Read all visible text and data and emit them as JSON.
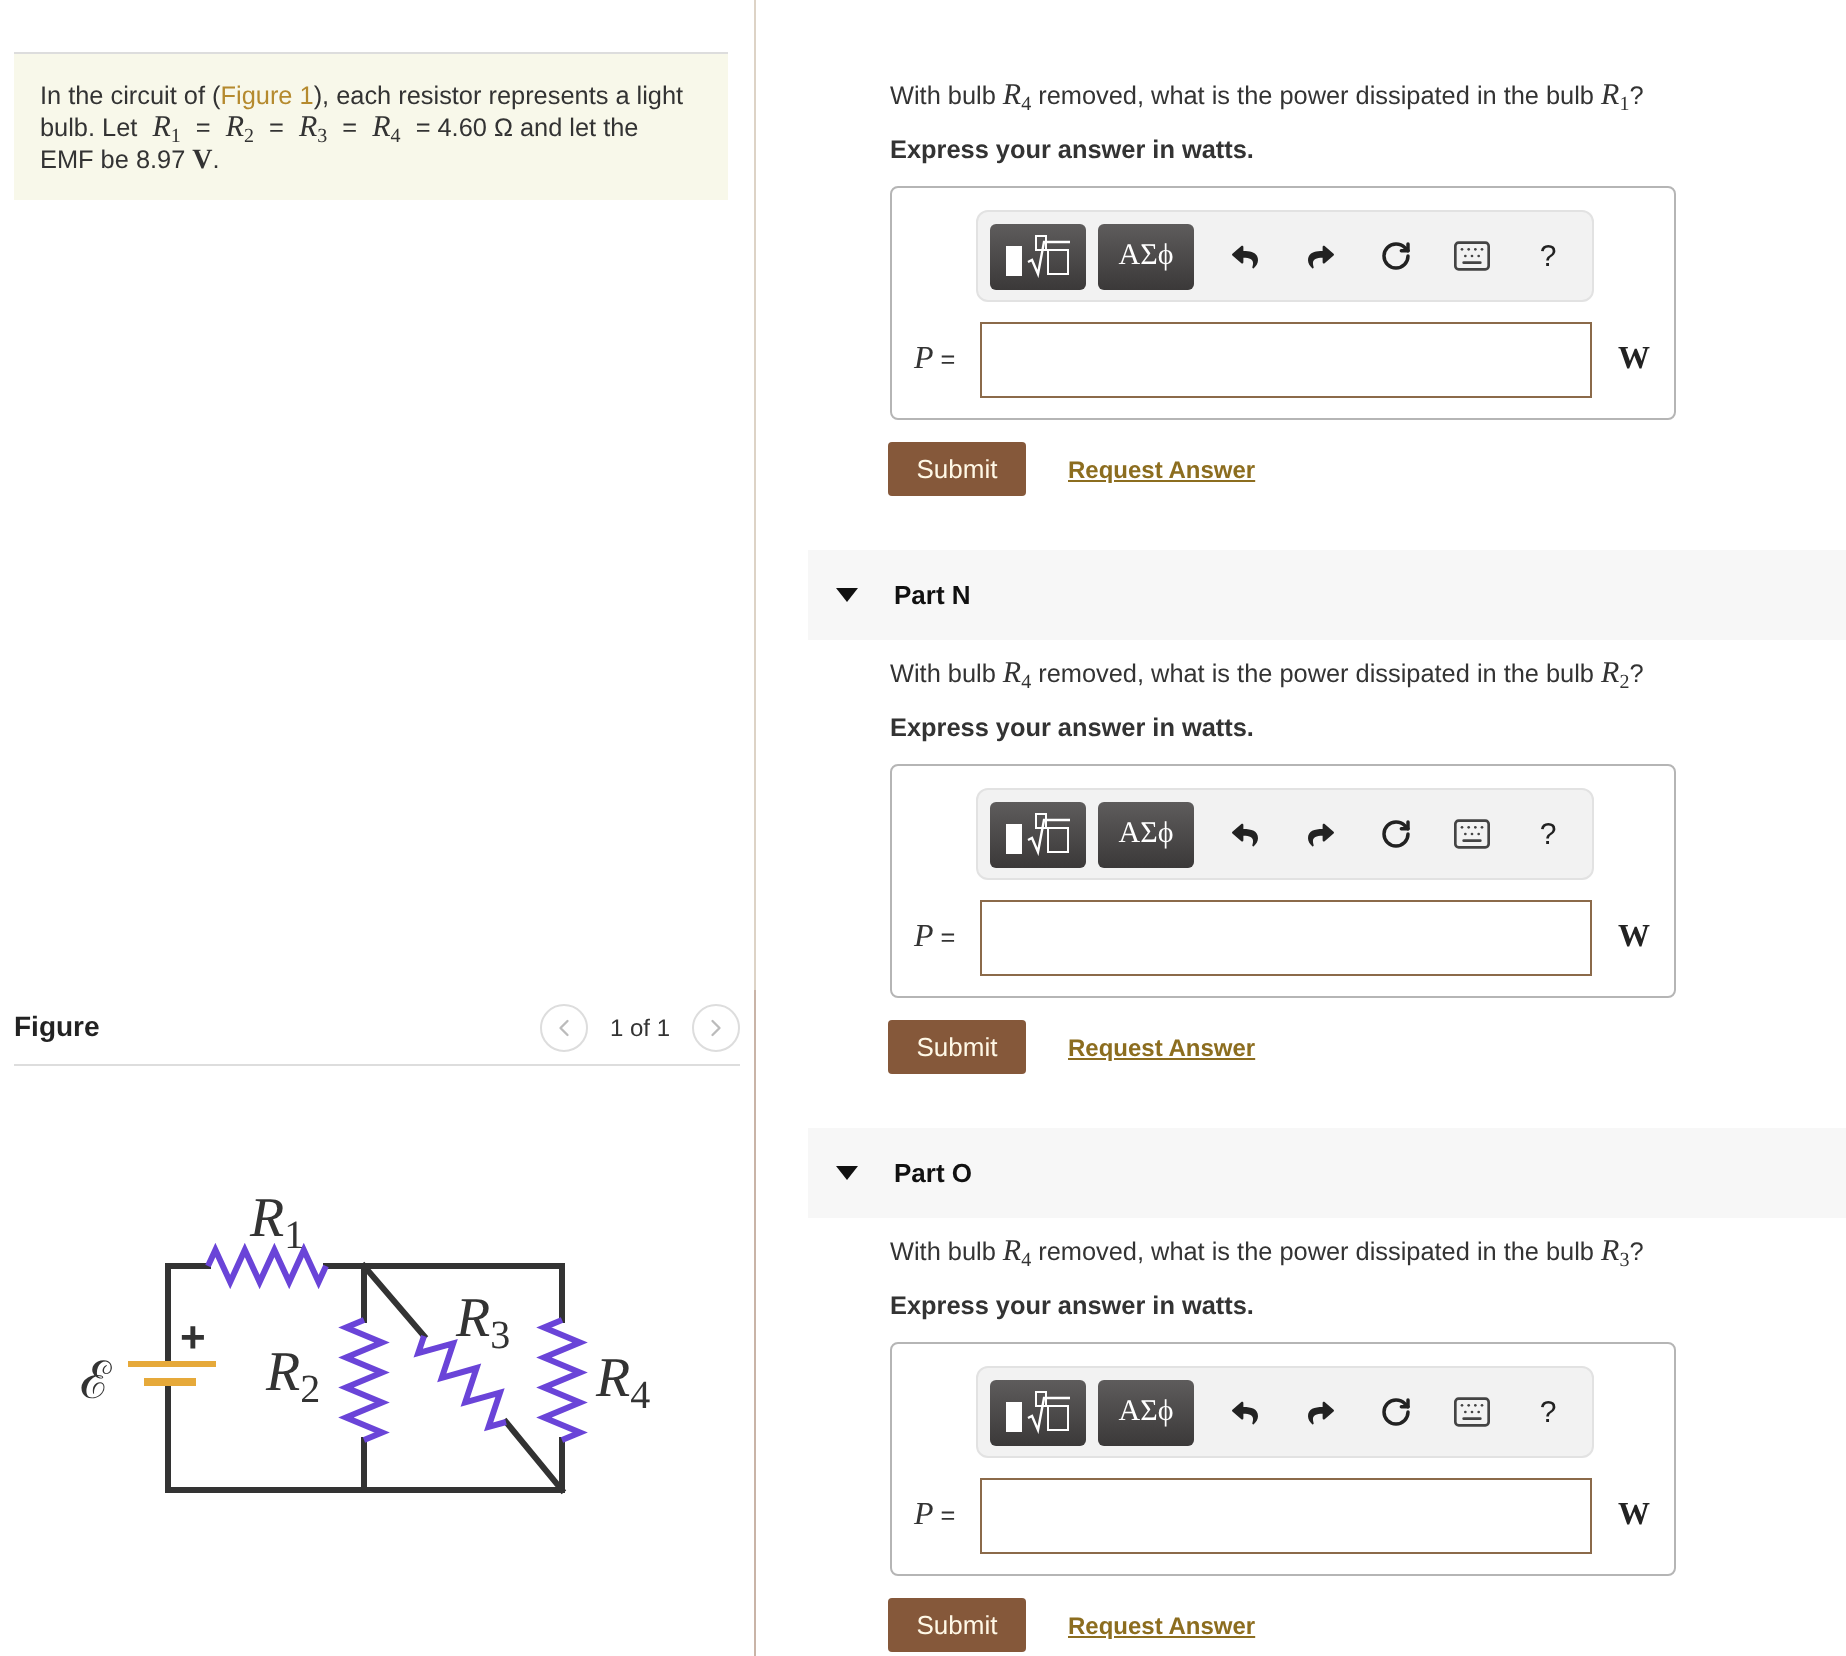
{
  "problem": {
    "text_before": "In the circuit of (",
    "figure_link": "Figure 1",
    "text_after": "), each resistor represents a light bulb. Let *R*$_{1}$ = *R*$_{2}$ = *R*$_{3}$ = *R*$_{4}$ = 4.60 Ω and let the EMF be 8.97 **V**."
  },
  "figure": {
    "title": "Figure",
    "pager": "1 of 1",
    "prev_button": {
      "disabled": true
    },
    "next_button": {
      "disabled": true
    },
    "circuit": {
      "emf_label": "ℰ",
      "plus_label": "+",
      "resistor_labels": [
        {
          "symbol": "R",
          "index": "1"
        },
        {
          "symbol": "R",
          "index": "2"
        },
        {
          "symbol": "R",
          "index": "3"
        },
        {
          "symbol": "R",
          "index": "4"
        }
      ]
    }
  },
  "parts": [
    {
      "question": "With bulb *R*$_{4}$ removed, what is the power dissipated in the bulb *R*$_{1}$?",
      "instruction": "Express your answer in watts.",
      "toolbar": {
        "symbols_button": "ΑΣϕ",
        "help_button": "?"
      },
      "answer": {
        "label": "*P* =",
        "unit": "W"
      },
      "submit_button": "Submit",
      "request_link": "Request Answer"
    },
    {
      "header": {
        "title": "Part N",
        "expanded": true
      },
      "question": "With bulb *R*$_{4}$ removed, what is the power dissipated in the bulb *R*$_{2}$?",
      "instruction": "Express your answer in watts.",
      "toolbar": {
        "symbols_button": "ΑΣϕ",
        "help_button": "?"
      },
      "answer": {
        "label": "*P* =",
        "unit": "W"
      },
      "submit_button": "Submit",
      "request_link": "Request Answer"
    },
    {
      "header": {
        "title": "Part O",
        "expanded": true
      },
      "question": "With bulb *R*$_{4}$ removed, what is the power dissipated in the bulb *R*$_{3}$?",
      "instruction": "Express your answer in watts.",
      "toolbar": {
        "symbols_button": "ΑΣϕ",
        "help_button": "?"
      },
      "answer": {
        "label": "*P* =",
        "unit": "W"
      },
      "submit_button": "Submit",
      "request_link": "Request Answer"
    }
  ]
}
